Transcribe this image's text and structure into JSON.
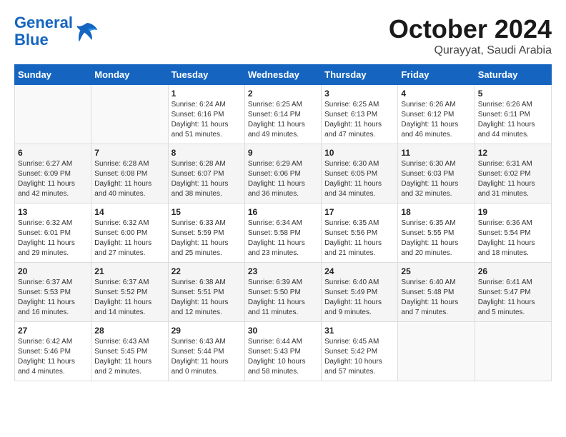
{
  "header": {
    "logo_line1": "General",
    "logo_line2": "Blue",
    "month": "October 2024",
    "location": "Qurayyat, Saudi Arabia"
  },
  "weekdays": [
    "Sunday",
    "Monday",
    "Tuesday",
    "Wednesday",
    "Thursday",
    "Friday",
    "Saturday"
  ],
  "weeks": [
    [
      {
        "day": "",
        "info": ""
      },
      {
        "day": "",
        "info": ""
      },
      {
        "day": "1",
        "info": "Sunrise: 6:24 AM\nSunset: 6:16 PM\nDaylight: 11 hours and 51 minutes."
      },
      {
        "day": "2",
        "info": "Sunrise: 6:25 AM\nSunset: 6:14 PM\nDaylight: 11 hours and 49 minutes."
      },
      {
        "day": "3",
        "info": "Sunrise: 6:25 AM\nSunset: 6:13 PM\nDaylight: 11 hours and 47 minutes."
      },
      {
        "day": "4",
        "info": "Sunrise: 6:26 AM\nSunset: 6:12 PM\nDaylight: 11 hours and 46 minutes."
      },
      {
        "day": "5",
        "info": "Sunrise: 6:26 AM\nSunset: 6:11 PM\nDaylight: 11 hours and 44 minutes."
      }
    ],
    [
      {
        "day": "6",
        "info": "Sunrise: 6:27 AM\nSunset: 6:09 PM\nDaylight: 11 hours and 42 minutes."
      },
      {
        "day": "7",
        "info": "Sunrise: 6:28 AM\nSunset: 6:08 PM\nDaylight: 11 hours and 40 minutes."
      },
      {
        "day": "8",
        "info": "Sunrise: 6:28 AM\nSunset: 6:07 PM\nDaylight: 11 hours and 38 minutes."
      },
      {
        "day": "9",
        "info": "Sunrise: 6:29 AM\nSunset: 6:06 PM\nDaylight: 11 hours and 36 minutes."
      },
      {
        "day": "10",
        "info": "Sunrise: 6:30 AM\nSunset: 6:05 PM\nDaylight: 11 hours and 34 minutes."
      },
      {
        "day": "11",
        "info": "Sunrise: 6:30 AM\nSunset: 6:03 PM\nDaylight: 11 hours and 32 minutes."
      },
      {
        "day": "12",
        "info": "Sunrise: 6:31 AM\nSunset: 6:02 PM\nDaylight: 11 hours and 31 minutes."
      }
    ],
    [
      {
        "day": "13",
        "info": "Sunrise: 6:32 AM\nSunset: 6:01 PM\nDaylight: 11 hours and 29 minutes."
      },
      {
        "day": "14",
        "info": "Sunrise: 6:32 AM\nSunset: 6:00 PM\nDaylight: 11 hours and 27 minutes."
      },
      {
        "day": "15",
        "info": "Sunrise: 6:33 AM\nSunset: 5:59 PM\nDaylight: 11 hours and 25 minutes."
      },
      {
        "day": "16",
        "info": "Sunrise: 6:34 AM\nSunset: 5:58 PM\nDaylight: 11 hours and 23 minutes."
      },
      {
        "day": "17",
        "info": "Sunrise: 6:35 AM\nSunset: 5:56 PM\nDaylight: 11 hours and 21 minutes."
      },
      {
        "day": "18",
        "info": "Sunrise: 6:35 AM\nSunset: 5:55 PM\nDaylight: 11 hours and 20 minutes."
      },
      {
        "day": "19",
        "info": "Sunrise: 6:36 AM\nSunset: 5:54 PM\nDaylight: 11 hours and 18 minutes."
      }
    ],
    [
      {
        "day": "20",
        "info": "Sunrise: 6:37 AM\nSunset: 5:53 PM\nDaylight: 11 hours and 16 minutes."
      },
      {
        "day": "21",
        "info": "Sunrise: 6:37 AM\nSunset: 5:52 PM\nDaylight: 11 hours and 14 minutes."
      },
      {
        "day": "22",
        "info": "Sunrise: 6:38 AM\nSunset: 5:51 PM\nDaylight: 11 hours and 12 minutes."
      },
      {
        "day": "23",
        "info": "Sunrise: 6:39 AM\nSunset: 5:50 PM\nDaylight: 11 hours and 11 minutes."
      },
      {
        "day": "24",
        "info": "Sunrise: 6:40 AM\nSunset: 5:49 PM\nDaylight: 11 hours and 9 minutes."
      },
      {
        "day": "25",
        "info": "Sunrise: 6:40 AM\nSunset: 5:48 PM\nDaylight: 11 hours and 7 minutes."
      },
      {
        "day": "26",
        "info": "Sunrise: 6:41 AM\nSunset: 5:47 PM\nDaylight: 11 hours and 5 minutes."
      }
    ],
    [
      {
        "day": "27",
        "info": "Sunrise: 6:42 AM\nSunset: 5:46 PM\nDaylight: 11 hours and 4 minutes."
      },
      {
        "day": "28",
        "info": "Sunrise: 6:43 AM\nSunset: 5:45 PM\nDaylight: 11 hours and 2 minutes."
      },
      {
        "day": "29",
        "info": "Sunrise: 6:43 AM\nSunset: 5:44 PM\nDaylight: 11 hours and 0 minutes."
      },
      {
        "day": "30",
        "info": "Sunrise: 6:44 AM\nSunset: 5:43 PM\nDaylight: 10 hours and 58 minutes."
      },
      {
        "day": "31",
        "info": "Sunrise: 6:45 AM\nSunset: 5:42 PM\nDaylight: 10 hours and 57 minutes."
      },
      {
        "day": "",
        "info": ""
      },
      {
        "day": "",
        "info": ""
      }
    ]
  ]
}
